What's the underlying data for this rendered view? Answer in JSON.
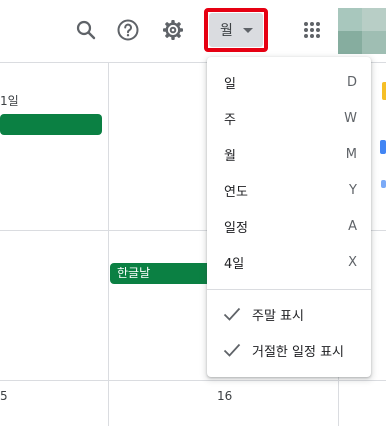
{
  "toolbar": {
    "view_label": "월",
    "icons": [
      "search-icon",
      "help-icon",
      "settings-icon",
      "apps-grid-icon"
    ]
  },
  "calendar": {
    "day_top_left": "1일",
    "day_bottom_left": "5",
    "day_bottom_middle": "16",
    "holiday_event": "한글날"
  },
  "view_menu": {
    "items": [
      {
        "label": "일",
        "key": "D"
      },
      {
        "label": "주",
        "key": "W"
      },
      {
        "label": "월",
        "key": "M"
      },
      {
        "label": "연도",
        "key": "Y"
      },
      {
        "label": "일정",
        "key": "A"
      },
      {
        "label": "4일",
        "key": "X"
      }
    ],
    "options": [
      {
        "label": "주말 표시",
        "checked": true
      },
      {
        "label": "거절한 일정 표시",
        "checked": true
      }
    ]
  },
  "colors": {
    "event_green": "#0b8043",
    "highlight_red": "#e60012",
    "view_button_bg": "#dadce0"
  }
}
